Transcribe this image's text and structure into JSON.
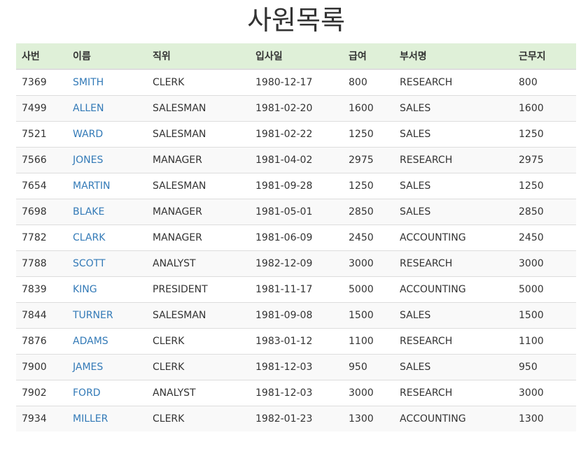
{
  "page": {
    "title": "사원목록"
  },
  "table": {
    "headers": [
      "사번",
      "이름",
      "직위",
      "입사일",
      "급여",
      "부서명",
      "근무지"
    ],
    "rows": [
      [
        "7369",
        "SMITH",
        "CLERK",
        "1980-12-17",
        "800",
        "RESEARCH",
        "800"
      ],
      [
        "7499",
        "ALLEN",
        "SALESMAN",
        "1981-02-20",
        "1600",
        "SALES",
        "1600"
      ],
      [
        "7521",
        "WARD",
        "SALESMAN",
        "1981-02-22",
        "1250",
        "SALES",
        "1250"
      ],
      [
        "7566",
        "JONES",
        "MANAGER",
        "1981-04-02",
        "2975",
        "RESEARCH",
        "2975"
      ],
      [
        "7654",
        "MARTIN",
        "SALESMAN",
        "1981-09-28",
        "1250",
        "SALES",
        "1250"
      ],
      [
        "7698",
        "BLAKE",
        "MANAGER",
        "1981-05-01",
        "2850",
        "SALES",
        "2850"
      ],
      [
        "7782",
        "CLARK",
        "MANAGER",
        "1981-06-09",
        "2450",
        "ACCOUNTING",
        "2450"
      ],
      [
        "7788",
        "SCOTT",
        "ANALYST",
        "1982-12-09",
        "3000",
        "RESEARCH",
        "3000"
      ],
      [
        "7839",
        "KING",
        "PRESIDENT",
        "1981-11-17",
        "5000",
        "ACCOUNTING",
        "5000"
      ],
      [
        "7844",
        "TURNER",
        "SALESMAN",
        "1981-09-08",
        "1500",
        "SALES",
        "1500"
      ],
      [
        "7876",
        "ADAMS",
        "CLERK",
        "1983-01-12",
        "1100",
        "RESEARCH",
        "1100"
      ],
      [
        "7900",
        "JAMES",
        "CLERK",
        "1981-12-03",
        "950",
        "SALES",
        "950"
      ],
      [
        "7902",
        "FORD",
        "ANALYST",
        "1981-12-03",
        "3000",
        "RESEARCH",
        "3000"
      ],
      [
        "7934",
        "MILLER",
        "CLERK",
        "1982-01-23",
        "1300",
        "ACCOUNTING",
        "1300"
      ]
    ]
  },
  "colors": {
    "header_background": "#dff0d8",
    "link": "#337ab7",
    "striped_row": "#f9f9f9",
    "border": "#dddddd"
  }
}
